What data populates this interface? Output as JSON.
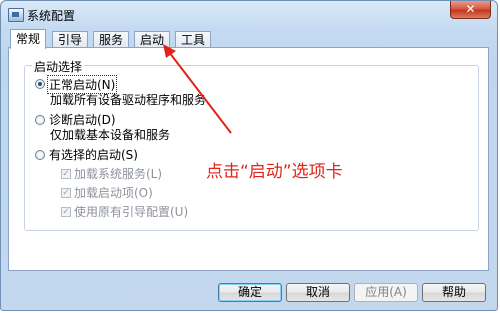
{
  "window": {
    "title": "系统配置",
    "close_glyph": "✕"
  },
  "tabs": [
    {
      "label": "常规",
      "active": true
    },
    {
      "label": "引导",
      "active": false
    },
    {
      "label": "服务",
      "active": false
    },
    {
      "label": "启动",
      "active": false
    },
    {
      "label": "工具",
      "active": false
    }
  ],
  "startup": {
    "group_label": "启动选择",
    "normal": {
      "label": "正常启动(N)",
      "desc": "加载所有设备驱动程序和服务",
      "selected": true
    },
    "diagnostic": {
      "label": "诊断启动(D)",
      "desc": "仅加载基本设备和服务",
      "selected": false
    },
    "selective": {
      "label": "有选择的启动(S)",
      "selected": false,
      "sub": [
        {
          "label": "加载系统服务(L)",
          "checked": true,
          "enabled": false
        },
        {
          "label": "加载启动项(O)",
          "checked": true,
          "enabled": false
        },
        {
          "label": "使用原有引导配置(U)",
          "checked": true,
          "enabled": false
        }
      ]
    }
  },
  "buttons": {
    "ok": "确定",
    "cancel": "取消",
    "apply": "应用(A)",
    "help": "帮助"
  },
  "annotation": {
    "text": "点击“启动”选项卡",
    "color": "#e2231a"
  }
}
